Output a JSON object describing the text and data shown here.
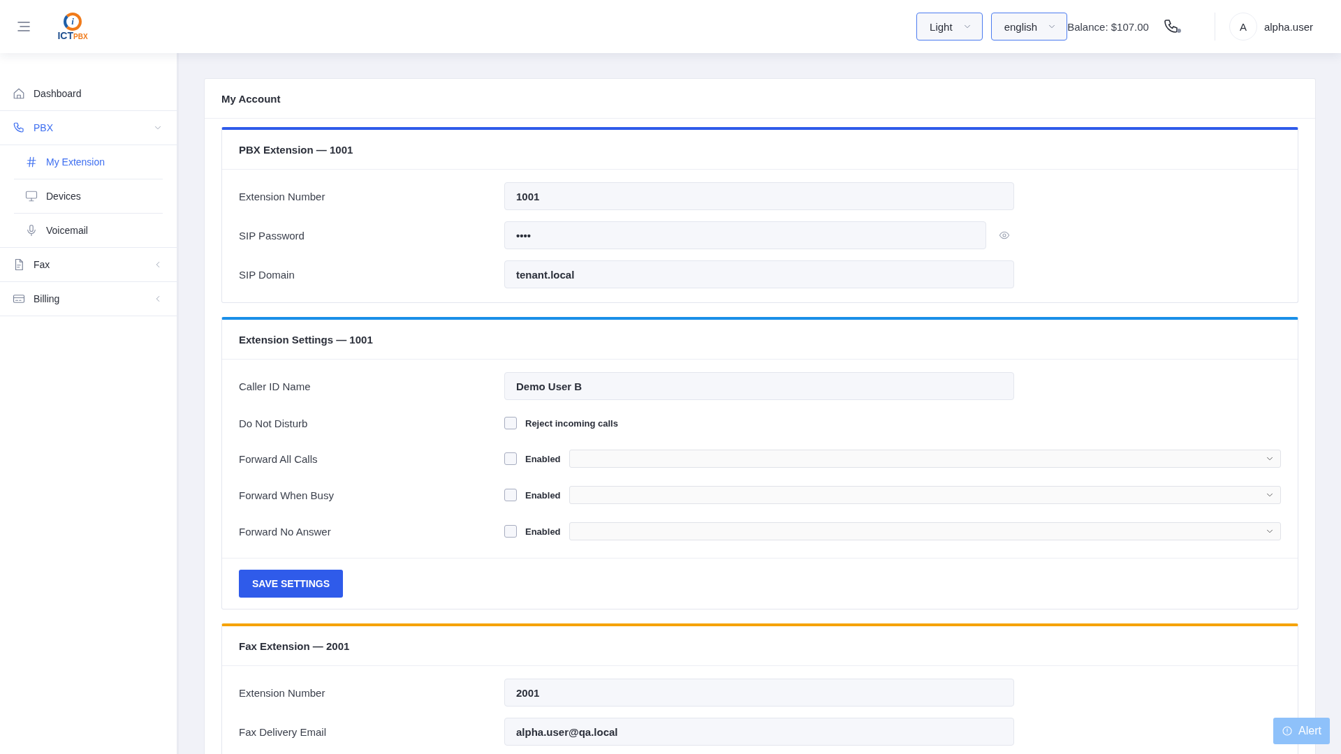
{
  "header": {
    "logo": {
      "mark": "i",
      "name": "ICT",
      "suffix": "PBX"
    },
    "theme_select": {
      "value": "Light"
    },
    "language_select": {
      "value": "english"
    },
    "balance": "Balance: $107.00",
    "user": {
      "avatar": "A",
      "name": "alpha.user"
    }
  },
  "sidebar": {
    "items": [
      {
        "label": "Dashboard",
        "kind": "link",
        "selected": false
      },
      {
        "label": "PBX",
        "kind": "group",
        "selected": true,
        "expanded": true,
        "children": [
          {
            "label": "My Extension",
            "selected": true
          },
          {
            "label": "Devices",
            "selected": false
          },
          {
            "label": "Voicemail",
            "selected": false
          }
        ]
      },
      {
        "label": "Fax",
        "kind": "group",
        "selected": false,
        "expanded": false
      },
      {
        "label": "Billing",
        "kind": "group",
        "selected": false,
        "expanded": false
      }
    ]
  },
  "page": {
    "title": "My Account",
    "sections": [
      {
        "title": "PBX Extension — 1001",
        "color": "#2f5bea",
        "fields": [
          {
            "kind": "text",
            "label": "Extension Number",
            "value": "1001"
          },
          {
            "kind": "password",
            "label": "SIP Password",
            "value": "••••"
          },
          {
            "kind": "text",
            "label": "SIP Domain",
            "value": "tenant.local"
          }
        ]
      },
      {
        "title": "Extension Settings — 1001",
        "color": "#1a8fe8",
        "fields": [
          {
            "kind": "text",
            "label": "Caller ID Name",
            "value": "Demo User B"
          },
          {
            "kind": "checkbox",
            "label": "Do Not Disturb",
            "option": "Reject incoming calls",
            "checked": false
          },
          {
            "kind": "forward",
            "label": "Forward All Calls",
            "option": "Enabled",
            "checked": false
          },
          {
            "kind": "forward",
            "label": "Forward When Busy",
            "option": "Enabled",
            "checked": false
          },
          {
            "kind": "forward",
            "label": "Forward No Answer",
            "option": "Enabled",
            "checked": false
          }
        ],
        "button": "SAVE SETTINGS"
      },
      {
        "title": "Fax Extension — 2001",
        "color": "#f5a300",
        "fields": [
          {
            "kind": "text",
            "label": "Extension Number",
            "value": "2001"
          },
          {
            "kind": "text",
            "label": "Fax Delivery Email",
            "value": "alpha.user@qa.local"
          }
        ]
      }
    ]
  },
  "alert_button": "Alert"
}
